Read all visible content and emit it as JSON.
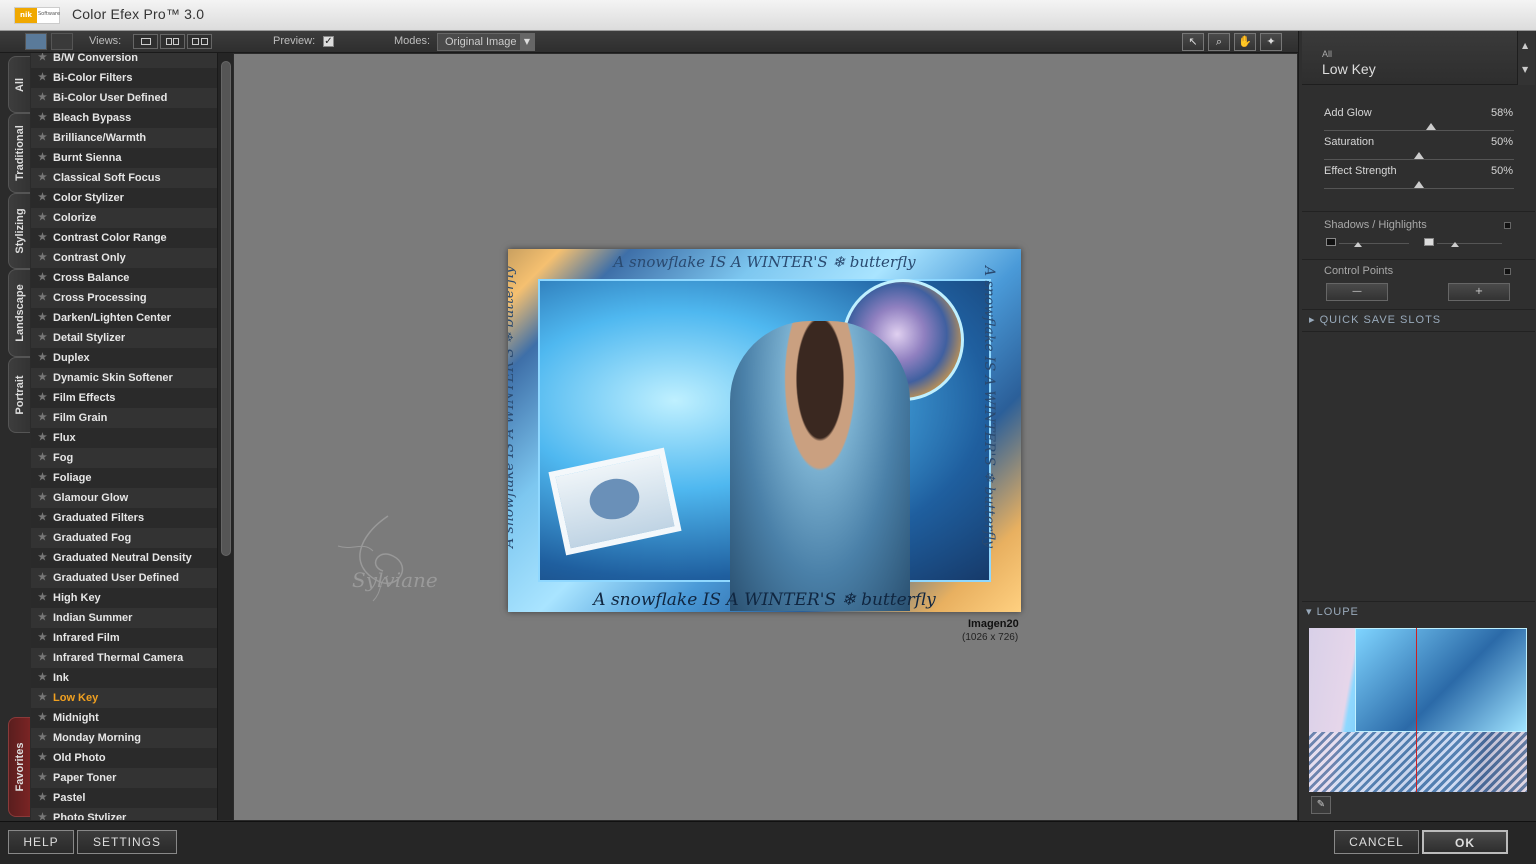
{
  "app": {
    "title": "Color Efex Pro™ 3.0",
    "logo_text": "nik",
    "logo_sub": "Software"
  },
  "toolbar": {
    "views_label": "Views:",
    "preview_label": "Preview:",
    "preview_checked": "✓",
    "modes_label": "Modes:",
    "mode_value": "Original Image",
    "tools": [
      "pointer-icon",
      "zoom-icon",
      "hand-icon",
      "control-point-icon"
    ]
  },
  "side_tabs": [
    "All",
    "Traditional",
    "Stylizing",
    "Landscape",
    "Portrait",
    "Favorites"
  ],
  "filters": [
    "B/W Conversion",
    "Bi-Color Filters",
    "Bi-Color User Defined",
    "Bleach Bypass",
    "Brilliance/Warmth",
    "Burnt Sienna",
    "Classical Soft Focus",
    "Color Stylizer",
    "Colorize",
    "Contrast Color Range",
    "Contrast Only",
    "Cross Balance",
    "Cross Processing",
    "Darken/Lighten Center",
    "Detail Stylizer",
    "Duplex",
    "Dynamic Skin Softener",
    "Film Effects",
    "Film Grain",
    "Flux",
    "Fog",
    "Foliage",
    "Glamour Glow",
    "Graduated Filters",
    "Graduated Fog",
    "Graduated Neutral Density",
    "Graduated User Defined",
    "High Key",
    "Indian Summer",
    "Infrared Film",
    "Infrared Thermal Camera",
    "Ink",
    "Low Key",
    "Midnight",
    "Monday Morning",
    "Old Photo",
    "Paper Toner",
    "Pastel",
    "Photo Stylizer"
  ],
  "active_filter": "Low Key",
  "image": {
    "name": "Imagen20",
    "size": "(1026 x 726)",
    "text_top": "A snowflake IS A WINTER'S ❄ butterfly",
    "text_bottom": "A snowflake IS A WINTER'S ❄ butterfly",
    "text_side": "A snowflake IS A WINTER'S ❄ butterfly",
    "watermark": "Sylviane"
  },
  "panel": {
    "category": "All",
    "filter_name": "Low Key",
    "sliders": [
      {
        "label": "Add Glow",
        "value": "58%",
        "fraction": 0.58
      },
      {
        "label": "Saturation",
        "value": "50%",
        "fraction": 0.5
      },
      {
        "label": "Effect Strength",
        "value": "50%",
        "fraction": 0.5
      }
    ],
    "shadows_label": "Shadows / Highlights",
    "control_points_label": "Control Points",
    "cp_remove": "—",
    "cp_add": "+",
    "quick_save": "QUICK SAVE SLOTS",
    "loupe": "LOUPE"
  },
  "buttons": {
    "help": "HELP",
    "settings": "SETTINGS",
    "cancel": "CANCEL",
    "ok": "OK"
  }
}
